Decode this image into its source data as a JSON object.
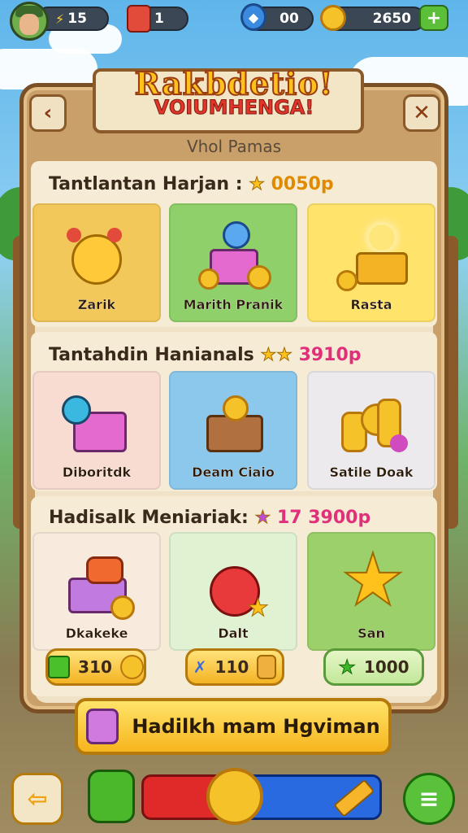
{
  "top_bar": {
    "lightning_value": "15",
    "gift_value": "1",
    "gems_value": "00",
    "coins_value": "2650"
  },
  "header": {
    "title_line1": "Rakbdetio!",
    "title_line2": "VOIUMHENGA!",
    "subtitle": "Vhol Pamas"
  },
  "sections": [
    {
      "title": "Tantlantan Harjan :",
      "price": "0050p",
      "cards": [
        {
          "label": "Zarik"
        },
        {
          "label": "Marith Pranik"
        },
        {
          "label": "Rasta"
        }
      ]
    },
    {
      "title": "Tantahdin Hanianals",
      "price": "3910p",
      "cards": [
        {
          "label": "Diboritdk"
        },
        {
          "label": "Deam Ciaio"
        },
        {
          "label": "Satile Doak"
        }
      ]
    },
    {
      "title": "Hadisalk Meniariak:",
      "price": "17 3900p",
      "cards": [
        {
          "label": "Dkakeke"
        },
        {
          "label": "Dalt"
        },
        {
          "label": "San"
        }
      ]
    }
  ],
  "prices": {
    "left": "310",
    "middle": "110",
    "right": "1000"
  },
  "main_button": {
    "label": "Hadilkh mam Hgviman"
  },
  "colors": {
    "panel_wood": "#c9a06a",
    "gold": "#f6c22a",
    "title_red": "#e4352a"
  }
}
